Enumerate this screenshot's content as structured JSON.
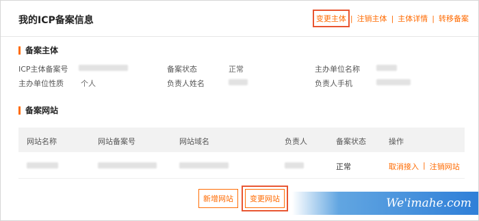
{
  "header": {
    "title": "我的ICP备案信息",
    "actions": [
      "变更主体",
      "注销主体",
      "主体详情",
      "转移备案"
    ],
    "separator": "|"
  },
  "subject": {
    "section_title": "备案主体",
    "row1": {
      "icp_label": "ICP主体备案号",
      "status_label": "备案状态",
      "status_value": "正常",
      "org_label": "主办单位名称"
    },
    "row2": {
      "nature_label": "主办单位性质",
      "nature_value": "个人",
      "person_label": "负责人姓名",
      "phone_label": "负责人手机"
    }
  },
  "websites": {
    "section_title": "备案网站",
    "columns": [
      "网站名称",
      "网站备案号",
      "网站域名",
      "负责人",
      "备案状态",
      "操作"
    ],
    "rows": [
      {
        "status": "正常",
        "actions": [
          "取消接入",
          "注销网站"
        ]
      }
    ]
  },
  "buttons": {
    "add_site": "新增网站",
    "change_site": "变更网站"
  },
  "watermark": {
    "text": "We'imahe.com"
  },
  "colors": {
    "accent": "#ff6a00",
    "highlight_box": "#e8542f",
    "watermark_blue": "#2f7fd8"
  }
}
